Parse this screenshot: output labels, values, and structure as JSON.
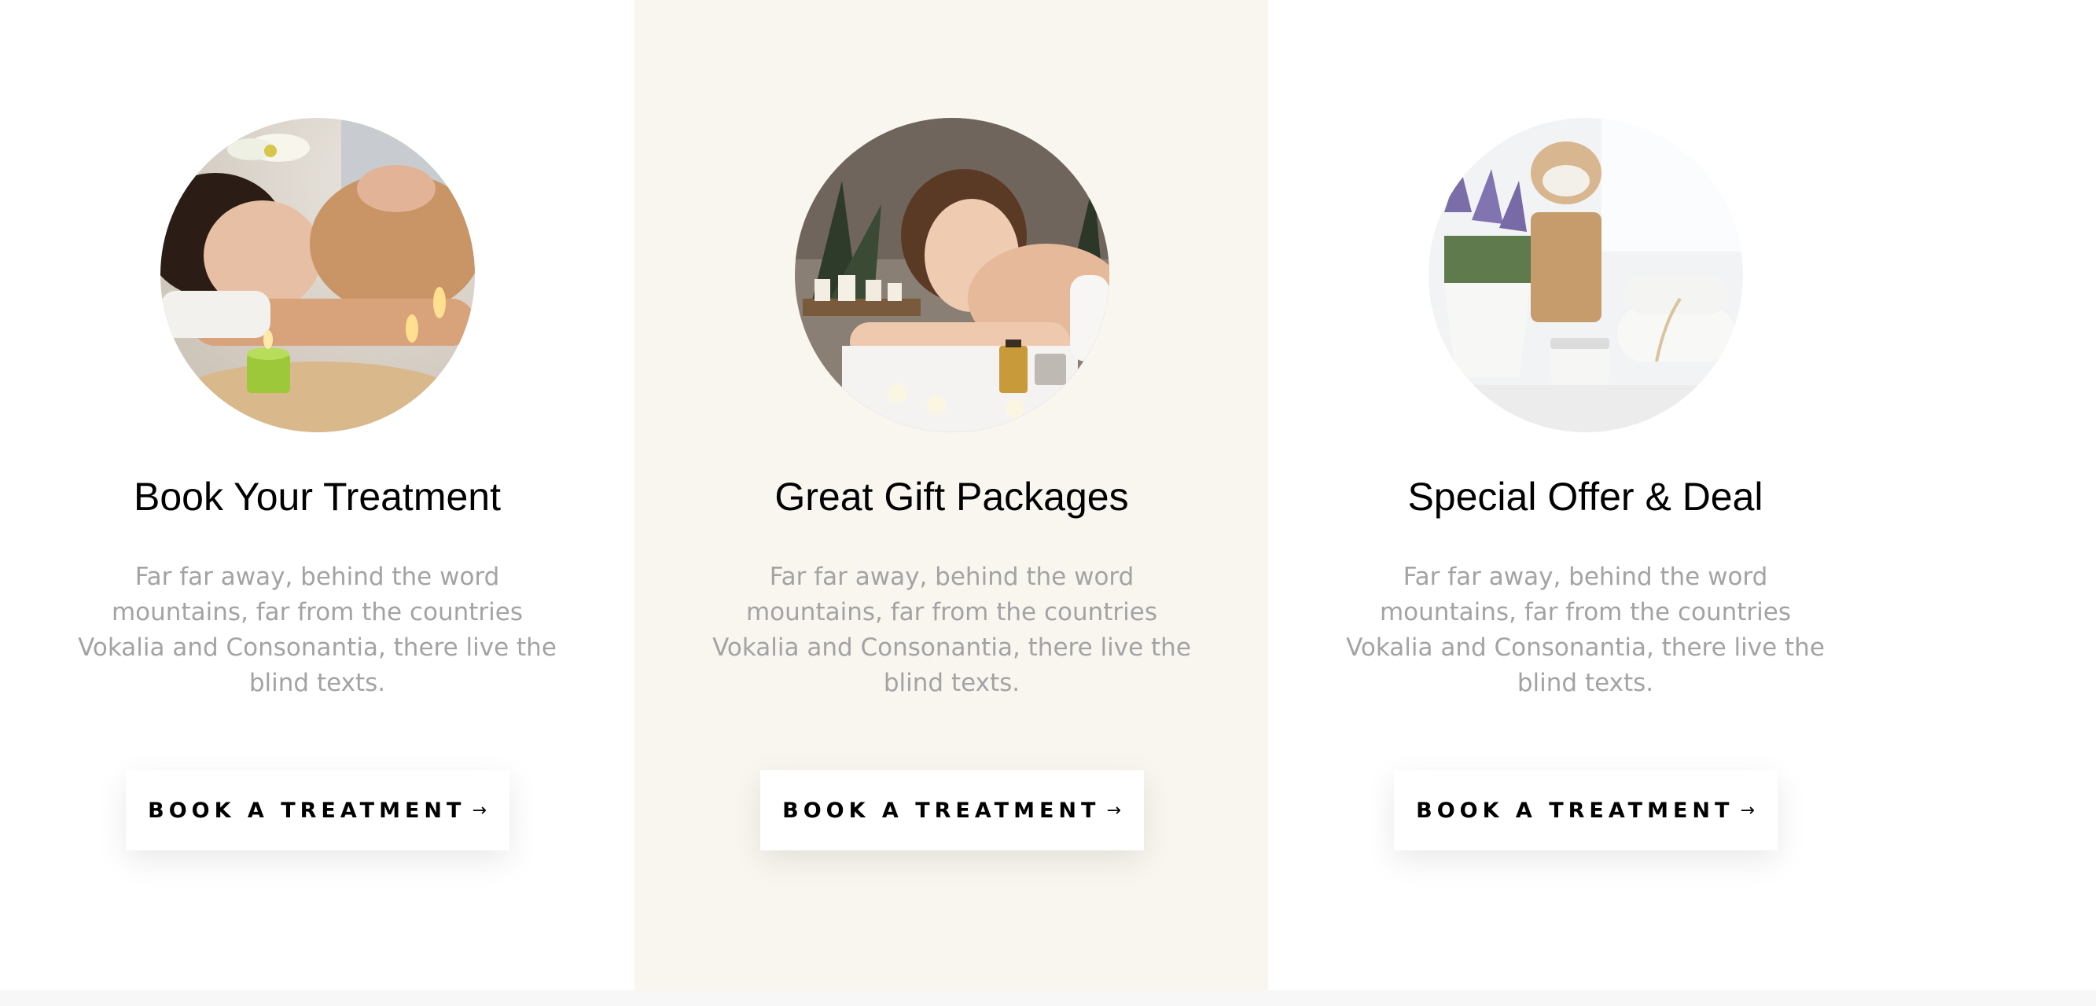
{
  "cards": [
    {
      "title": "Book Your Treatment",
      "description": "Far far away, behind the word mountains, far from the countries Vokalia and Consonantia, there live the blind texts.",
      "button_label": "BOOK A TREATMENT",
      "button_icon": "arrow-right-icon",
      "image": "spa-massage-photo"
    },
    {
      "title": "Great Gift Packages",
      "description": "Far far away, behind the word mountains, far from the countries Vokalia and Consonantia, there live the blind texts.",
      "button_label": "BOOK A TREATMENT",
      "button_icon": "arrow-right-icon",
      "image": "spa-woman-relaxing-photo"
    },
    {
      "title": "Special Offer & Deal",
      "description": "Far far away, behind the word mountains, far from the countries Vokalia and Consonantia, there live the blind texts.",
      "button_label": "BOOK A TREATMENT",
      "button_icon": "arrow-right-icon",
      "image": "spa-lavender-products-photo"
    }
  ],
  "arrow_glyph": "→",
  "colors": {
    "background": "#ffffff",
    "highlight_column": "#f9f6f0",
    "title": "#000000",
    "description": "#a3a3a3",
    "button_bg": "#ffffff"
  }
}
